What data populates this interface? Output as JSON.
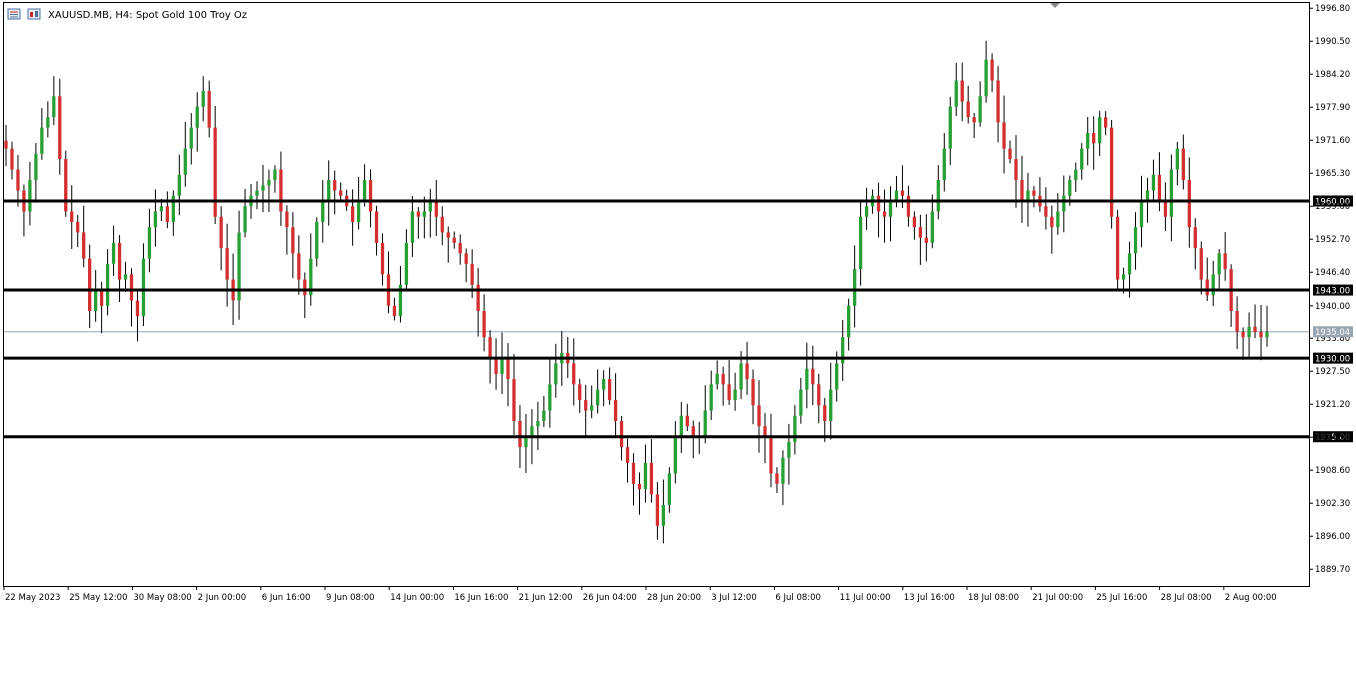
{
  "header": {
    "title": "XAUUSD.MB, H4:  Spot Gold 100 Troy Oz"
  },
  "chart_data": {
    "type": "candlestick",
    "symbol": "XAUUSD.MB",
    "timeframe": "H4",
    "ylim": [
      1886.5,
      1997.8
    ],
    "price_ticks": [
      "1996.80",
      "1990.50",
      "1984.20",
      "1977.90",
      "1971.60",
      "1965.30",
      "1959.00",
      "1952.70",
      "1946.40",
      "1940.00",
      "1933.80",
      "1927.50",
      "1921.20",
      "1914.90",
      "1908.60",
      "1902.30",
      "1896.00",
      "1889.70"
    ],
    "time_labels": [
      "22 May 2023",
      "25 May 12:00",
      "30 May 08:00",
      "2 Jun 00:00",
      "6 Jun 16:00",
      "9 Jun 08:00",
      "14 Jun 00:00",
      "16 Jun 16:00",
      "21 Jun 12:00",
      "26 Jun 04:00",
      "28 Jun 20:00",
      "3 Jul 12:00",
      "6 Jul 08:00",
      "11 Jul 00:00",
      "13 Jul 16:00",
      "18 Jul 08:00",
      "21 Jul 00:00",
      "25 Jul 16:00",
      "28 Jul 08:00",
      "2 Aug 00:00"
    ],
    "horizontal_lines": [
      {
        "price": 1960.0,
        "label": "1960.00"
      },
      {
        "price": 1943.0,
        "label": "1943.00"
      },
      {
        "price": 1930.0,
        "label": "1930.00"
      },
      {
        "price": 1915.0,
        "label": "1915.00"
      }
    ],
    "current_price": {
      "price": 1935.04,
      "label": "1935.04"
    },
    "candle_colors": {
      "up": "#26a033",
      "down": "#d32f2f",
      "wick": "#000000"
    },
    "closes": [
      1970,
      1966,
      1962,
      1958,
      1964,
      1969,
      1974,
      1976,
      1980,
      1968,
      1958,
      1956,
      1954,
      1949,
      1939,
      1943,
      1940,
      1948,
      1952,
      1945,
      1946,
      1941,
      1938,
      1949,
      1955,
      1958,
      1959,
      1956,
      1961,
      1965,
      1970,
      1974,
      1978,
      1981,
      1974,
      1957,
      1951,
      1945,
      1941,
      1954,
      1959,
      1961,
      1962,
      1963,
      1964,
      1966,
      1958,
      1955,
      1950,
      1945,
      1942,
      1949,
      1956,
      1960,
      1964,
      1962,
      1961,
      1959,
      1956,
      1960,
      1964,
      1958,
      1952,
      1946,
      1940,
      1938,
      1944,
      1952,
      1958,
      1957,
      1958,
      1960,
      1957,
      1954,
      1953,
      1952,
      1950,
      1948,
      1944,
      1939,
      1934,
      1930,
      1927,
      1930,
      1926,
      1918,
      1913,
      1915,
      1917,
      1918,
      1920,
      1925,
      1929,
      1931,
      1929,
      1925,
      1922,
      1920,
      1921,
      1924,
      1926,
      1922,
      1918,
      1913,
      1910,
      1906,
      1905,
      1910,
      1904,
      1898,
      1902,
      1908,
      1915,
      1919,
      1917,
      1915,
      1915,
      1920,
      1925,
      1927,
      1925,
      1922,
      1924,
      1929,
      1926,
      1921,
      1917,
      1915,
      1908,
      1906,
      1911,
      1914,
      1919,
      1924,
      1928,
      1925,
      1921,
      1918,
      1924,
      1929,
      1934,
      1940,
      1947,
      1957,
      1959,
      1961,
      1958,
      1957,
      1960,
      1962,
      1961,
      1957,
      1955,
      1953,
      1952,
      1958,
      1964,
      1970,
      1978,
      1983,
      1979,
      1976,
      1975,
      1980,
      1987,
      1983,
      1975,
      1970,
      1968,
      1964,
      1960,
      1962,
      1961,
      1959,
      1957,
      1955,
      1958,
      1961,
      1964,
      1966,
      1970,
      1973,
      1971,
      1976,
      1974,
      1957,
      1945,
      1946,
      1950,
      1955,
      1960,
      1962,
      1965,
      1960,
      1957,
      1966,
      1970,
      1964,
      1955,
      1951,
      1945,
      1942,
      1946,
      1950,
      1947,
      1939,
      1935,
      1934,
      1936,
      1935,
      1934,
      1935
    ]
  }
}
